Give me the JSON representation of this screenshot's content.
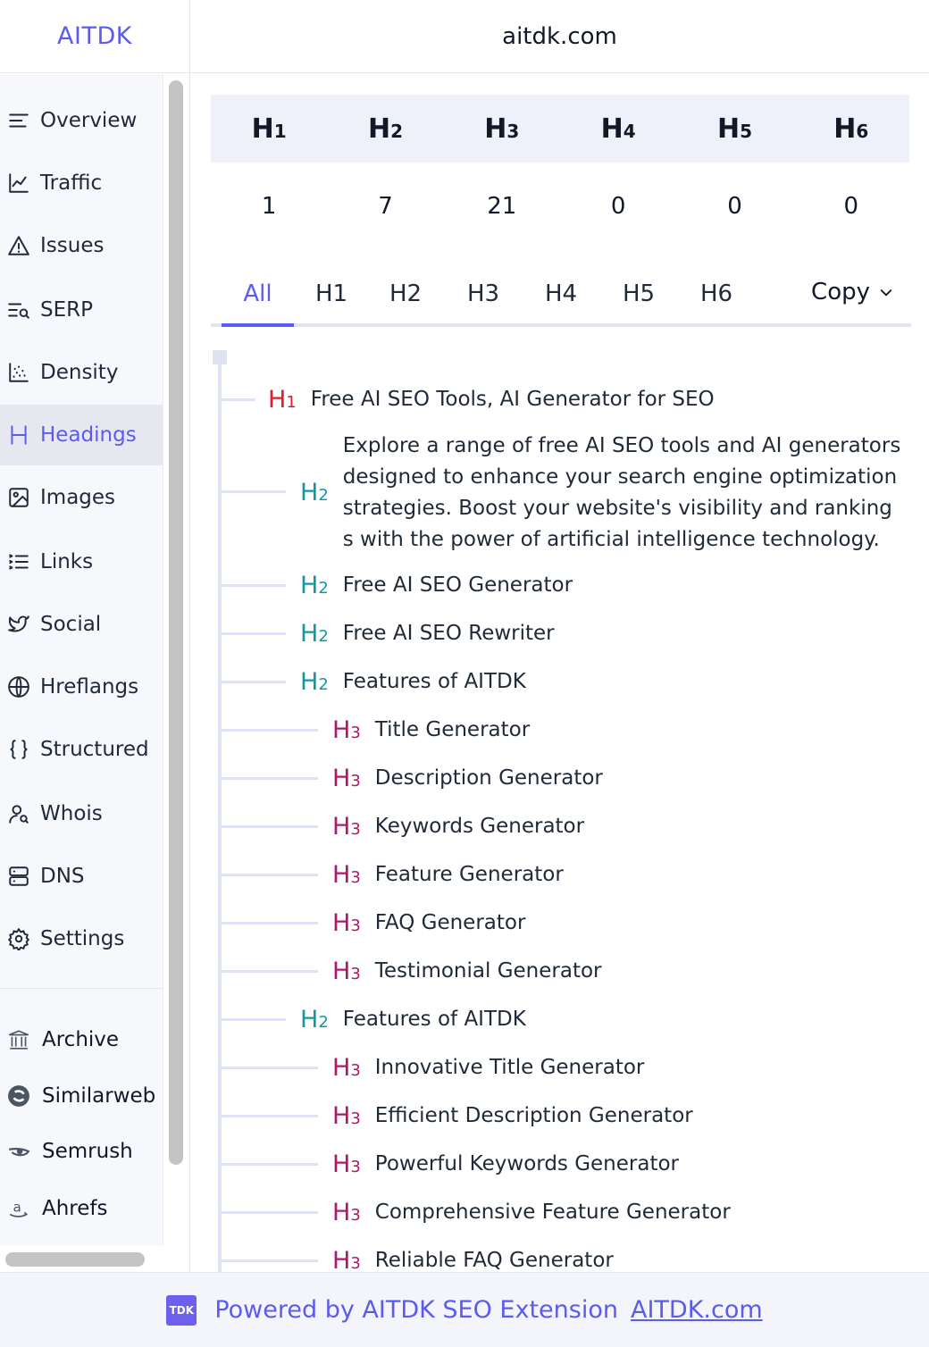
{
  "header": {
    "brand": "AITDK",
    "domain": "aitdk.com"
  },
  "sidebar": {
    "items": [
      {
        "label": "Overview",
        "icon": "list-icon"
      },
      {
        "label": "Traffic",
        "icon": "chart-line-icon"
      },
      {
        "label": "Issues",
        "icon": "warning-icon"
      },
      {
        "label": "SERP",
        "icon": "serp-icon"
      },
      {
        "label": "Density",
        "icon": "scatter-icon"
      },
      {
        "label": "Headings",
        "icon": "heading-icon",
        "active": true
      },
      {
        "label": "Images",
        "icon": "image-icon"
      },
      {
        "label": "Links",
        "icon": "links-icon"
      },
      {
        "label": "Social",
        "icon": "twitter-icon"
      },
      {
        "label": "Hreflangs",
        "icon": "globe-icon"
      },
      {
        "label": "Structured",
        "icon": "braces-icon"
      },
      {
        "label": "Whois",
        "icon": "user-search-icon"
      },
      {
        "label": "DNS",
        "icon": "server-icon"
      },
      {
        "label": "Settings",
        "icon": "gear-icon"
      }
    ],
    "external": [
      {
        "label": "Archive",
        "icon": "archive-icon"
      },
      {
        "label": "Similarweb",
        "icon": "similarweb-icon"
      },
      {
        "label": "Semrush",
        "icon": "semrush-icon"
      },
      {
        "label": "Ahrefs",
        "icon": "amazon-icon"
      }
    ],
    "accent_color": "#5b5bf0"
  },
  "heading_stats": {
    "levels": [
      {
        "tag": "H",
        "num": "1",
        "count": "1"
      },
      {
        "tag": "H",
        "num": "2",
        "count": "7"
      },
      {
        "tag": "H",
        "num": "3",
        "count": "21"
      },
      {
        "tag": "H",
        "num": "4",
        "count": "0"
      },
      {
        "tag": "H",
        "num": "5",
        "count": "0"
      },
      {
        "tag": "H",
        "num": "6",
        "count": "0"
      }
    ]
  },
  "tabs": {
    "items": [
      "All",
      "H1",
      "H2",
      "H3",
      "H4",
      "H5",
      "H6"
    ],
    "active": "All",
    "copy_label": "Copy"
  },
  "headings": [
    {
      "level": "1",
      "text": "Free AI SEO Tools, AI Generator for SEO"
    },
    {
      "level": "2",
      "text": "Explore a range of free AI SEO tools and AI generators designed to enhance your search engine optimization strategies. Boost your website's visibility and rankings with the power of artificial intelligence technology."
    },
    {
      "level": "2",
      "text": "Free AI SEO Generator"
    },
    {
      "level": "2",
      "text": "Free AI SEO Rewriter"
    },
    {
      "level": "2",
      "text": "Features of AITDK"
    },
    {
      "level": "3",
      "text": "Title Generator"
    },
    {
      "level": "3",
      "text": "Description Generator"
    },
    {
      "level": "3",
      "text": "Keywords Generator"
    },
    {
      "level": "3",
      "text": "Feature Generator"
    },
    {
      "level": "3",
      "text": "FAQ Generator"
    },
    {
      "level": "3",
      "text": "Testimonial Generator"
    },
    {
      "level": "2",
      "text": "Features of AITDK"
    },
    {
      "level": "3",
      "text": "Innovative Title Generator"
    },
    {
      "level": "3",
      "text": "Efficient Description Generator"
    },
    {
      "level": "3",
      "text": "Powerful Keywords Generator"
    },
    {
      "level": "3",
      "text": "Comprehensive Feature Generator"
    },
    {
      "level": "3",
      "text": "Reliable FAQ Generator"
    }
  ],
  "heading_colors": {
    "h1": "#e11d2a",
    "h2": "#1596a6",
    "h3": "#b0176a"
  },
  "footer": {
    "badge": "TDK",
    "text": "Powered by AITDK SEO Extension",
    "link": "AITDK.com"
  }
}
